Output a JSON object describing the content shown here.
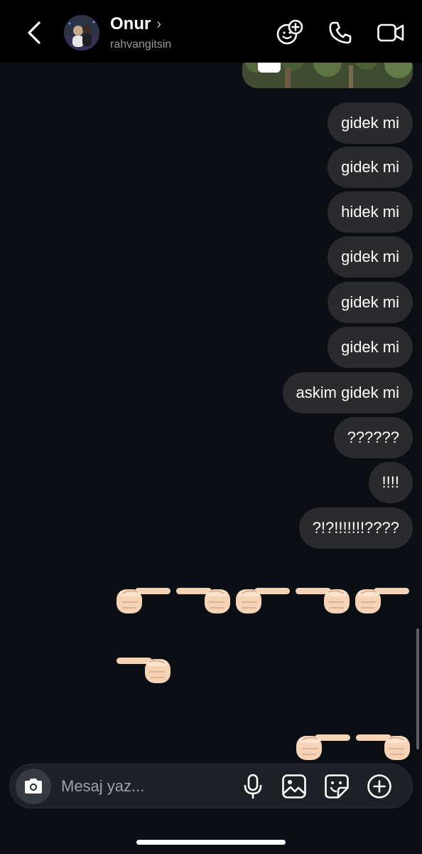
{
  "header": {
    "name": "Onur",
    "username": "rahvangitsin",
    "chevron": "›",
    "icons": [
      "back-arrow-icon",
      "effects-icon",
      "phone-icon",
      "video-icon"
    ]
  },
  "messages": [
    {
      "text": "gidek mi"
    },
    {
      "text": "gidek mi"
    },
    {
      "text": "hidek mi"
    },
    {
      "text": "gidek mi"
    },
    {
      "text": "gidek mi"
    },
    {
      "text": "gidek mi"
    },
    {
      "text": "askim gidek mi"
    },
    {
      "text": "??????"
    },
    {
      "text": "!!!!"
    },
    {
      "text": "?!?!!!!!!!????"
    }
  ],
  "emoji_rows": [
    {
      "emojis": [
        "👉",
        "👈",
        "👉",
        "👈",
        "👉"
      ]
    },
    {
      "emojis": [
        "👈"
      ]
    },
    {
      "emojis": [
        "👉",
        "👈"
      ]
    }
  ],
  "composer": {
    "placeholder": "Mesaj yaz...",
    "icons": [
      "camera-icon",
      "microphone-icon",
      "gallery-icon",
      "sticker-icon",
      "add-icon"
    ]
  }
}
